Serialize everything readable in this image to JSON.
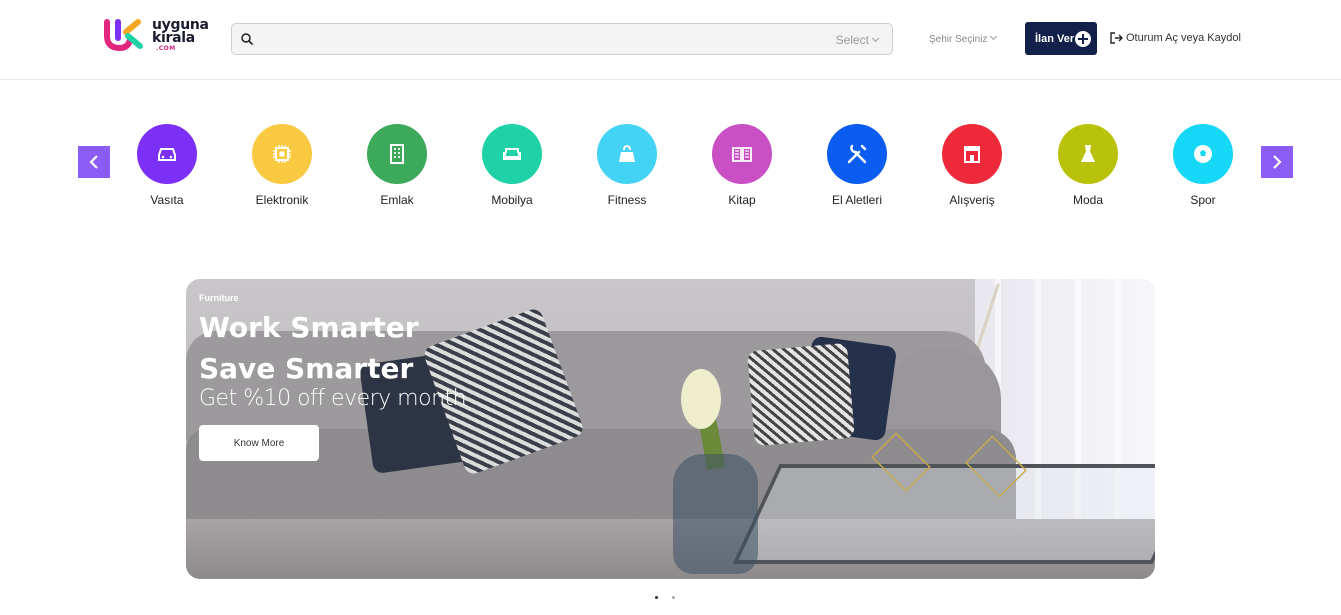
{
  "header": {
    "logo_line1": "uyguna",
    "logo_line2": "kirala",
    "logo_suffix": ".COM",
    "search": {
      "value": "",
      "placeholder": "",
      "select_label": "Select"
    },
    "city_select": "Şehir Seçiniz",
    "post_ad_label": "İlan Ver",
    "login_label": "Oturum Aç veya Kaydol"
  },
  "categories": [
    {
      "label": "Vasıta",
      "color": "#7b2ff7",
      "icon": "car-icon"
    },
    {
      "label": "Elektronik",
      "color": "#f9c941",
      "icon": "chip-icon"
    },
    {
      "label": "Emlak",
      "color": "#3da95a",
      "icon": "building-icon"
    },
    {
      "label": "Mobilya",
      "color": "#1ed1a6",
      "icon": "sofa-icon"
    },
    {
      "label": "Fitness",
      "color": "#42d3f5",
      "icon": "kettlebell-icon"
    },
    {
      "label": "Kitap",
      "color": "#c94fc4",
      "icon": "book-icon"
    },
    {
      "label": "El Aletleri",
      "color": "#0b5cf0",
      "icon": "tools-icon"
    },
    {
      "label": "Alışveriş",
      "color": "#ee2a3a",
      "icon": "store-icon"
    },
    {
      "label": "Moda",
      "color": "#b8c20a",
      "icon": "dress-icon"
    },
    {
      "label": "Spor",
      "color": "#14d8f5",
      "icon": "ball-icon"
    }
  ],
  "hero": {
    "kicker": "Furniture",
    "title": "Work Smarter Save Smarter",
    "subtitle": "Get %10 off every month",
    "button_label": "Know More"
  },
  "carousel": {
    "slides": 2,
    "active_index": 0,
    "dot_active_color": "#333333",
    "dot_inactive_color": "#aaaaaa"
  },
  "colors": {
    "accent": "#8b5cf6",
    "brand_navy": "#12204a"
  }
}
